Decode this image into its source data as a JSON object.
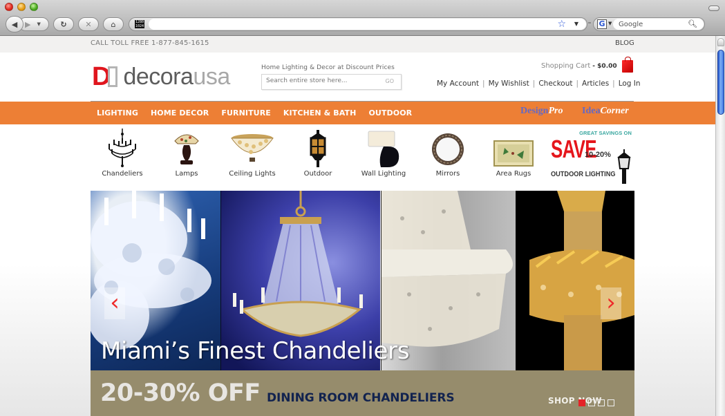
{
  "browser": {
    "url": "",
    "search_engine": "Google",
    "search_placeholder": "Google",
    "site_icon_text": "1280 1024"
  },
  "topbar": {
    "phone": "CALL TOLL FREE 1-877-845-1615",
    "blog": "BLOG"
  },
  "header": {
    "logo_letter": "D",
    "logo_main": "decora",
    "logo_accent": "usa",
    "tagline": "Home Lighting & Decor at Discount Prices",
    "search_placeholder": "Search entire store here...",
    "search_button": "GO",
    "cart_label": "Shopping Cart",
    "cart_total": "- $0.00",
    "account_links": [
      "My Account",
      "My Wishlist",
      "Checkout",
      "Articles",
      "Log In"
    ]
  },
  "nav": {
    "items": [
      "LIGHTING",
      "HOME DECOR",
      "FURNITURE",
      "KITCHEN & BATH",
      "OUTDOOR"
    ],
    "promos": [
      {
        "first": "Design",
        "second": "Pro"
      },
      {
        "first": "Idea",
        "second": "Corner"
      }
    ]
  },
  "categories": [
    {
      "label": "Chandeliers",
      "icon": "chandelier-icon"
    },
    {
      "label": "Lamps",
      "icon": "lamp-icon"
    },
    {
      "label": "Ceiling Lights",
      "icon": "ceiling-light-icon"
    },
    {
      "label": "Outdoor",
      "icon": "lantern-icon"
    },
    {
      "label": "Wall Lighting",
      "icon": "wall-sconce-icon"
    },
    {
      "label": "Mirrors",
      "icon": "mirror-icon"
    },
    {
      "label": "Area Rugs",
      "icon": "rug-icon"
    }
  ],
  "savings": {
    "great": "GREAT SAVINGS ON",
    "save": "SAVE",
    "percent": "10-20%",
    "category": "OUTDOOR LIGHTING"
  },
  "hero": {
    "headline": "Miami’s Finest Chandeliers",
    "offer": "20-30% OFF",
    "offer_category": "DINING ROOM CHANDELIERS",
    "cta": "SHOP NOW",
    "prev": "‹",
    "next": "›",
    "slides_total": 4,
    "active_slide": 1
  },
  "colors": {
    "brand_orange": "#ed7f35",
    "logo_red": "#e0161e",
    "offer_bar": "#968c6c",
    "offer_text": "#12234f",
    "promo_blue": "#6469c4"
  }
}
